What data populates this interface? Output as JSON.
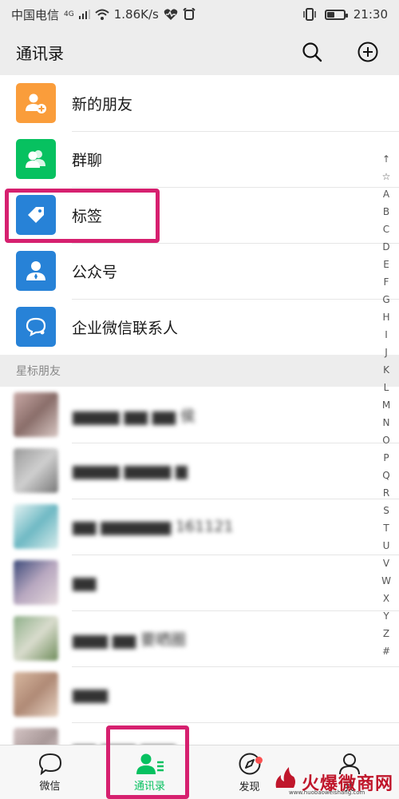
{
  "status_bar": {
    "carrier": "中国电信",
    "signal_label": "4G",
    "speed": "1.86K/s",
    "time": "21:30"
  },
  "header": {
    "title": "通讯录",
    "search_icon": "search-icon",
    "add_icon": "plus-circle-icon"
  },
  "functions": [
    {
      "label": "新的朋友",
      "icon": "add-friend-icon",
      "color": "#fa9d3b"
    },
    {
      "label": "群聊",
      "icon": "group-icon",
      "color": "#07c160"
    },
    {
      "label": "标签",
      "icon": "tag-icon",
      "color": "#2782d7"
    },
    {
      "label": "公众号",
      "icon": "official-account-icon",
      "color": "#2782d7"
    },
    {
      "label": "企业微信联系人",
      "icon": "enterprise-contact-icon",
      "color": "#2782d7"
    }
  ],
  "section": {
    "starred_title": "星标朋友"
  },
  "contacts": [
    {
      "name": "▆▆▆▆ ▆▆ ▆▆ 侯"
    },
    {
      "name": "▆▆▆▆ ▆▆▆▆ ▆"
    },
    {
      "name": "▆▆ ▆▆▆▆▆▆ 161121"
    },
    {
      "name": "▆▆"
    },
    {
      "name": "▆▆▆ ▆▆ 要晒圈"
    },
    {
      "name": "▆▆▆"
    },
    {
      "name": "▆▆ ▆▆▆ ▆▆▆"
    }
  ],
  "index_letters": [
    "↑",
    "☆",
    "A",
    "B",
    "C",
    "D",
    "E",
    "F",
    "G",
    "H",
    "I",
    "J",
    "K",
    "L",
    "M",
    "N",
    "O",
    "P",
    "Q",
    "R",
    "S",
    "T",
    "U",
    "V",
    "W",
    "X",
    "Y",
    "Z",
    "#"
  ],
  "tabs": [
    {
      "label": "微信",
      "icon": "chat-bubble-icon",
      "active": false
    },
    {
      "label": "通讯录",
      "icon": "contacts-icon",
      "active": true
    },
    {
      "label": "发现",
      "icon": "compass-icon",
      "active": false,
      "badge": true
    },
    {
      "label": "我",
      "icon": "person-icon",
      "active": false
    }
  ],
  "watermark": {
    "main": "火爆微商网",
    "sub": "www.huobaoweishang.com"
  },
  "colors": {
    "accent": "#07c160",
    "highlight": "#d6206f",
    "badge": "#fa5151"
  }
}
